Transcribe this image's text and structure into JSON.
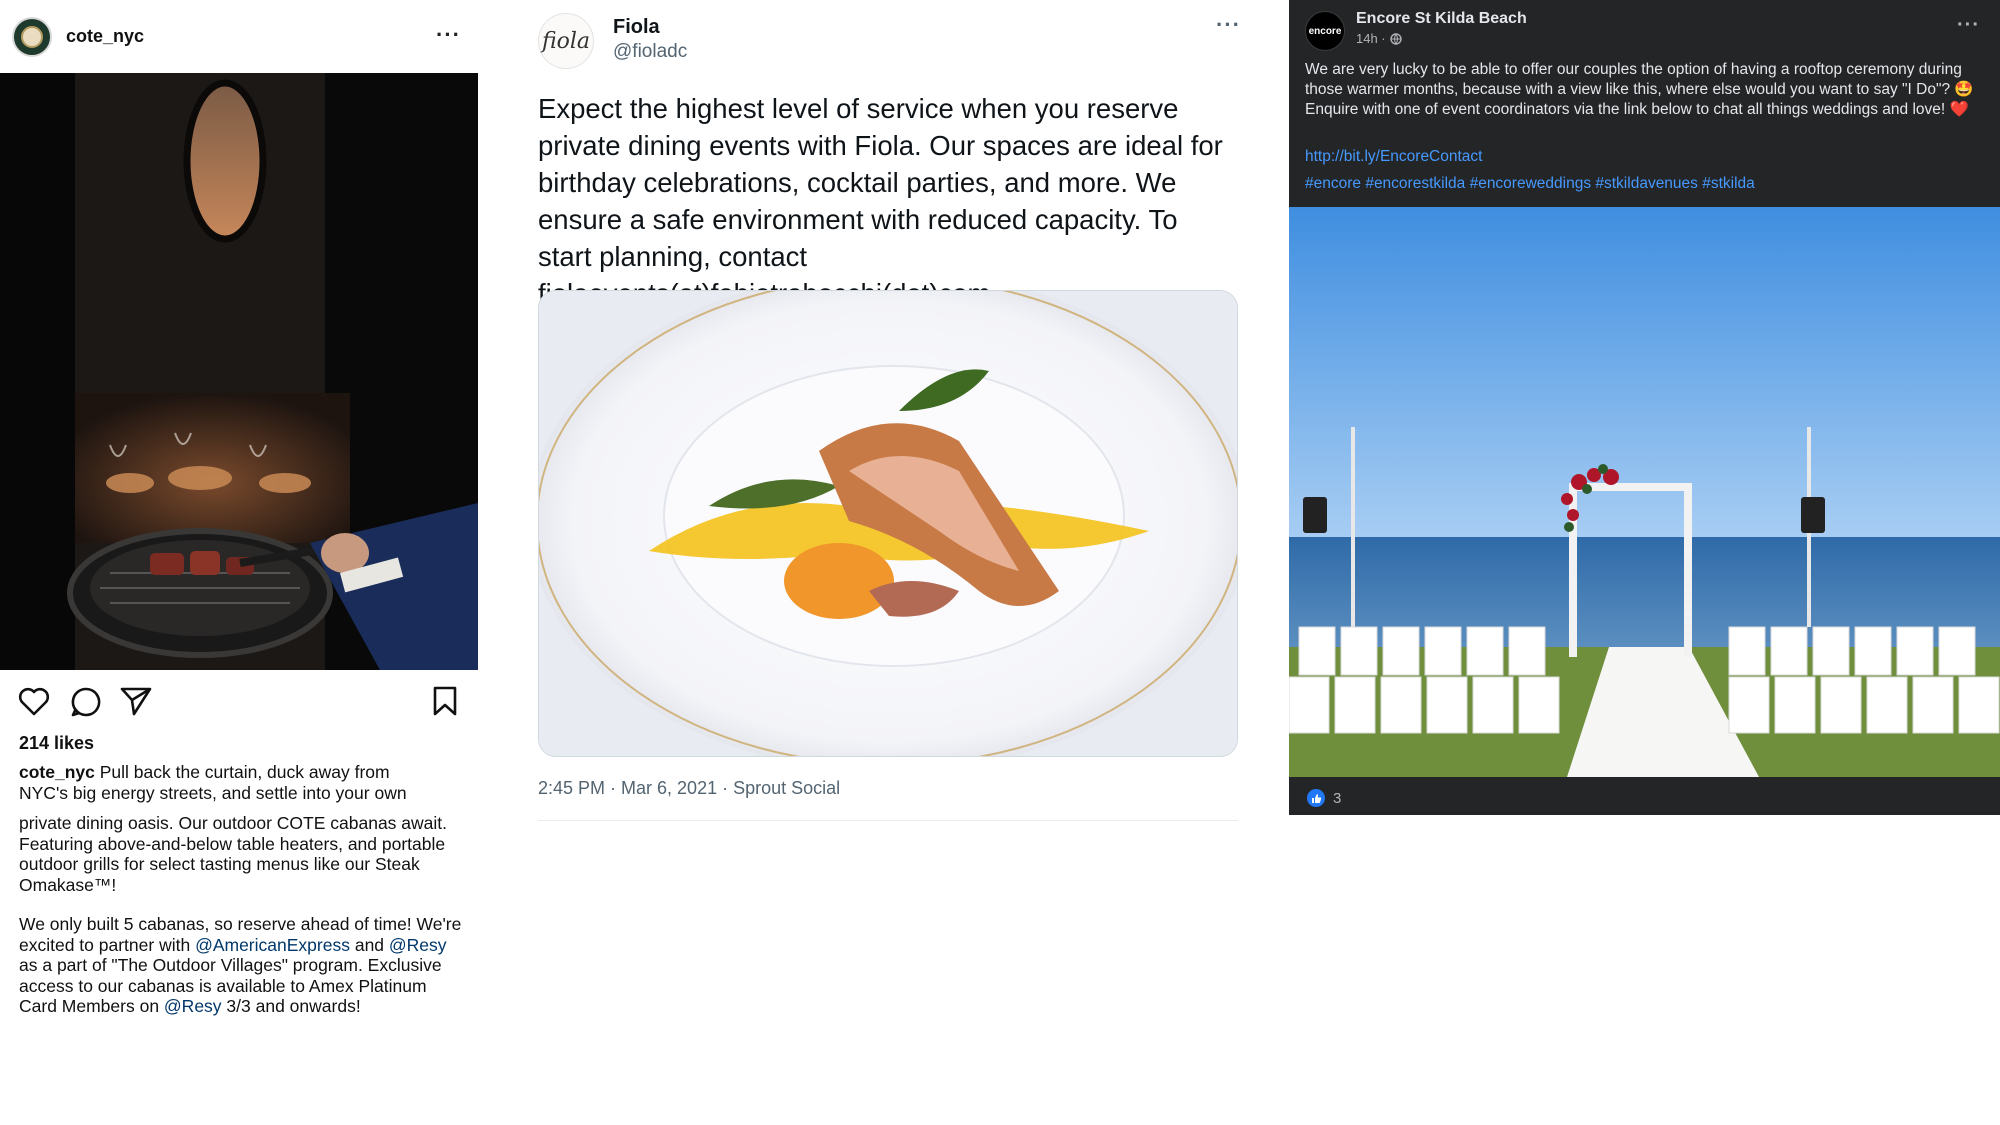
{
  "instagram": {
    "username": "cote_nyc",
    "more_icon": "more-horizontal-icon",
    "likes": "214 likes",
    "caption": {
      "author": "cote_nyc",
      "p1_line1": "Pull back the curtain, duck away from",
      "p1_line2": "NYC's big energy streets, and settle into your own",
      "p2": "private dining oasis. Our outdoor COTE cabanas await. Featuring above-and-below table heaters, and portable outdoor grills for select tasting menus like our Steak Omakase™!",
      "p3_a": "We only built 5 cabanas, so reserve ahead of time! We're excited to partner with ",
      "mention_amex": "@AmericanExpress",
      "p3_b": " and ",
      "mention_resy1": "@Resy",
      "p3_c": " as a part of \"The Outdoor Villages\" program. Exclusive access to our cabanas is available to Amex Platinum Card Members on ",
      "mention_resy2": "@Resy",
      "p3_d": " 3/3 and onwards!"
    },
    "icons": [
      "heart-icon",
      "comment-icon",
      "share-icon",
      "bookmark-icon"
    ]
  },
  "twitter": {
    "name": "Fiola",
    "handle": "@fioladc",
    "avatar_logo": "fiola",
    "text": "Expect the highest level of service when you reserve private dining events with Fiola. Our spaces are ideal for birthday celebrations, cocktail parties, and more. We ensure a safe environment with reduced capacity. To start planning, contact fiolaevents(at)fabiotrabocchi(dot)com.",
    "meta": "2:45 PM · Mar 6, 2021 · Sprout Social"
  },
  "facebook": {
    "page_name": "Encore St Kilda Beach",
    "avatar_text": "encore",
    "time": "14h ·",
    "text_a": "We are very lucky to be able to offer our couples the option of having a rooftop ceremony during those warmer months, because with a view like this, where else would you want to say \"I Do\"? ",
    "emoji1": "🤩",
    "text_b": " Enquire with one of event coordinators via the link below to chat all things weddings and love! ",
    "emoji2": "❤️",
    "link": "http://bit.ly/EncoreContact",
    "hashtags": "#encore #encorestkilda #encoreweddings #stkildavenues #stkilda",
    "reaction_count": "3",
    "colors": {
      "background": "#242526",
      "link": "#4599ff",
      "like": "#2078f4"
    }
  }
}
